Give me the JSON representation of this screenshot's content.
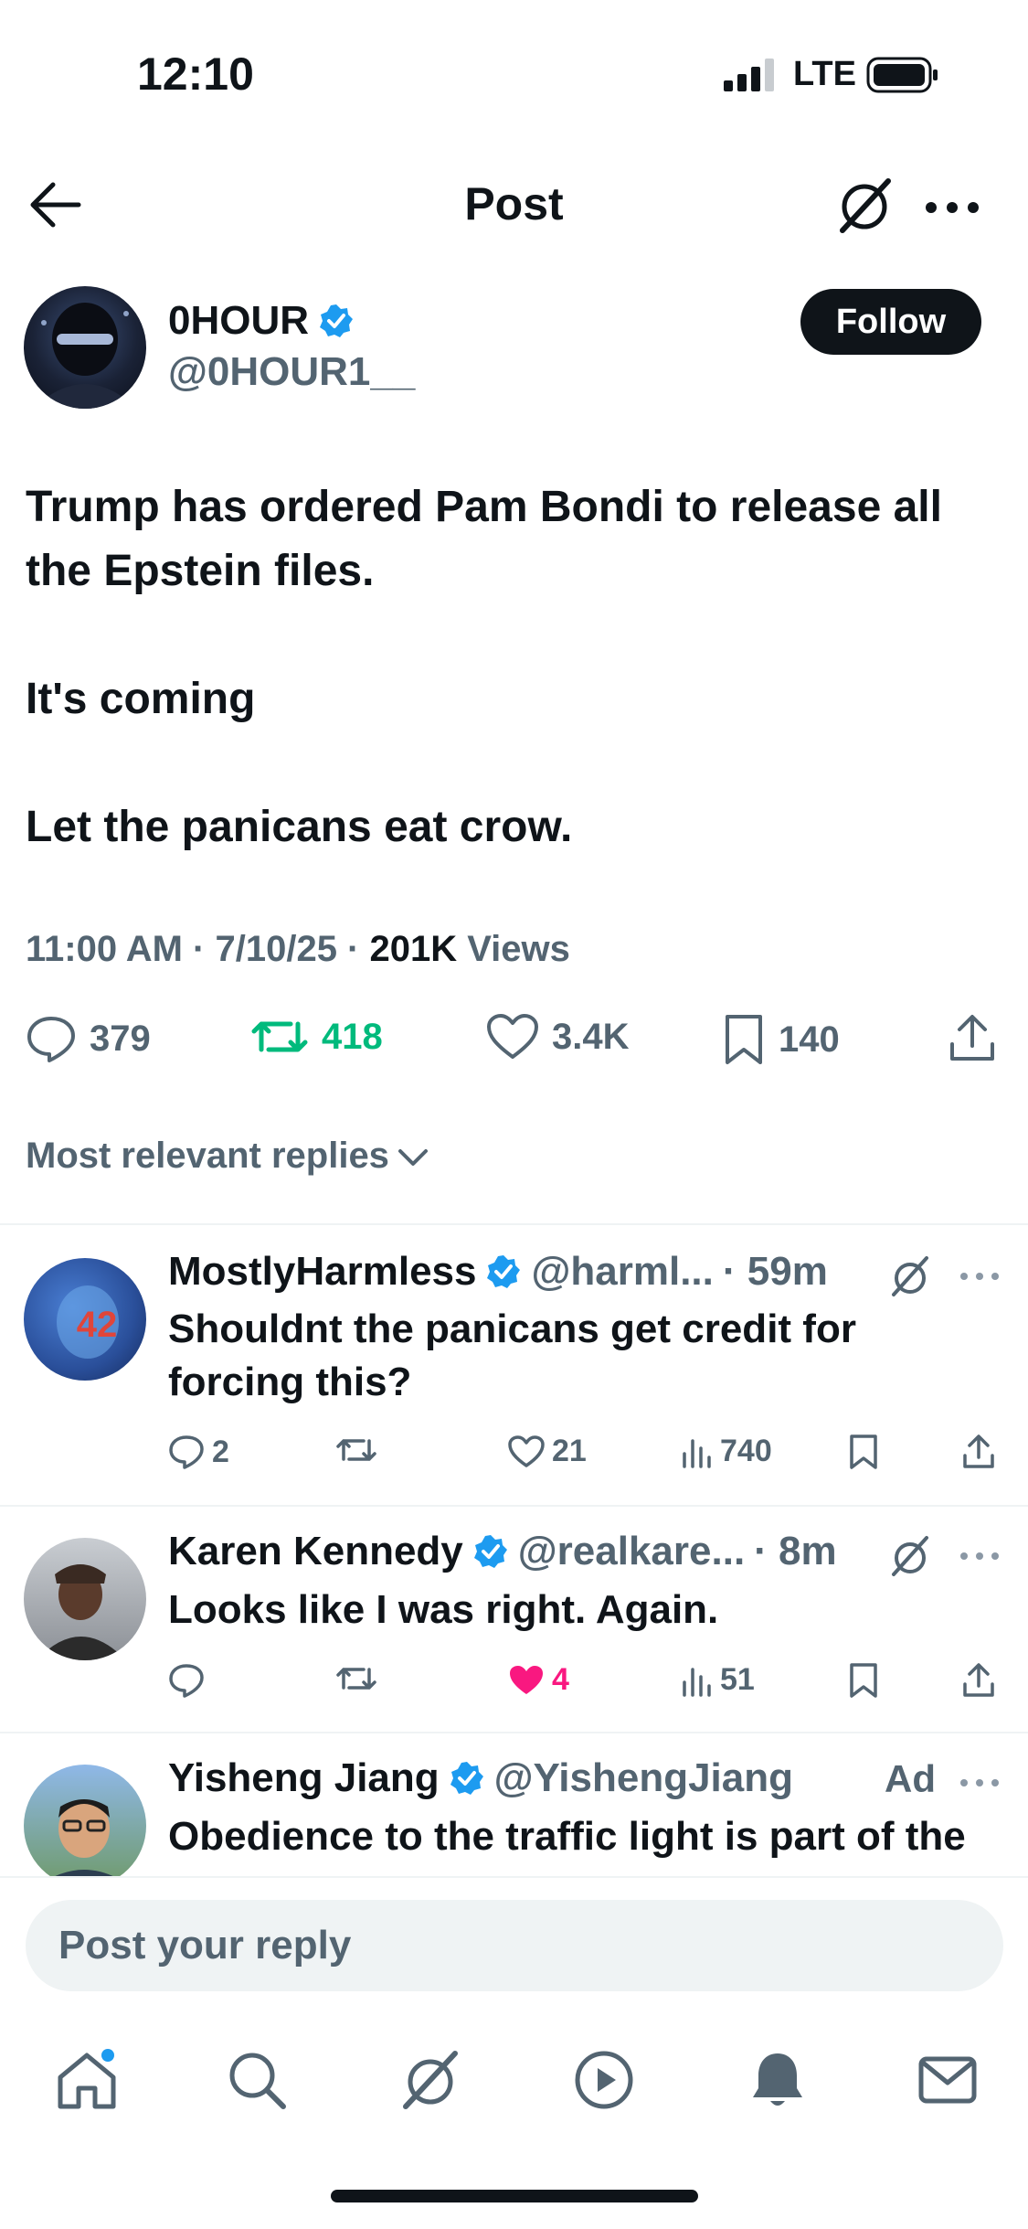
{
  "status_bar": {
    "time": "12:10",
    "network": "LTE"
  },
  "header": {
    "title": "Post"
  },
  "post": {
    "author_name": "0HOUR",
    "author_handle": "@0HOUR1__",
    "follow_label": "Follow",
    "text_lines": [
      "Trump has ordered Pam Bondi to release all the Epstein files.",
      "It's coming",
      "Let the panicans eat crow."
    ],
    "timestamp": "11:00 AM · 7/10/25 · ",
    "views_count": "201K",
    "views_label": " Views",
    "replies": "379",
    "reposts": "418",
    "likes": "3.4K",
    "bookmarks": "140"
  },
  "sort_label": "Most relevant replies",
  "replies": [
    {
      "name": "MostlyHarmless",
      "handle": "@harml...",
      "time": "· 59m",
      "text": "Shouldnt the panicans get credit for forcing this?",
      "replies": "2",
      "reposts": "",
      "likes": "21",
      "views": "740",
      "avatar_text": "42"
    },
    {
      "name": "Karen Kennedy",
      "handle": "@realkare...",
      "time": "· 8m",
      "text": "Looks like I was right. Again.",
      "replies": "",
      "reposts": "",
      "likes": "4",
      "views": "51"
    },
    {
      "name": "Yisheng Jiang",
      "handle": "@YishengJiang",
      "ad_label": "Ad",
      "text": "Obedience to the traffic light is part of the"
    }
  ],
  "reply_placeholder": "Post your reply",
  "colors": {
    "accent_blue": "#1d9bf0",
    "repost_green": "#00ba7c",
    "like_pink": "#f91880",
    "text": "#0f1419",
    "muted": "#536471"
  }
}
